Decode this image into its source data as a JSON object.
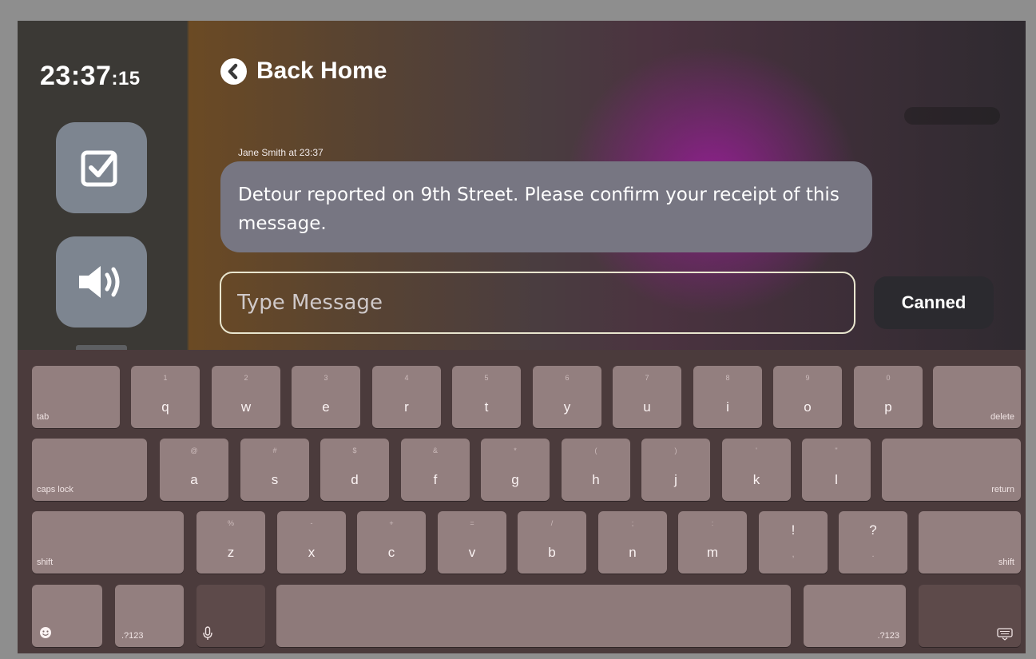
{
  "clock": {
    "hm": "23:37",
    "sec": ":15"
  },
  "sidebar": {
    "items": [
      {
        "icon": "checkbox-icon"
      },
      {
        "icon": "speaker-icon"
      }
    ]
  },
  "header": {
    "back_label": "Back Home"
  },
  "message": {
    "sender": "Jane Smith at 23:37",
    "text": "Detour reported on 9th Street. Please confirm your receipt of this message."
  },
  "compose": {
    "placeholder": "Type Message",
    "canned_label": "Canned"
  },
  "keyboard": {
    "row1": [
      {
        "key": "q",
        "alt": "1"
      },
      {
        "key": "w",
        "alt": "2"
      },
      {
        "key": "e",
        "alt": "3"
      },
      {
        "key": "r",
        "alt": "4"
      },
      {
        "key": "t",
        "alt": "5"
      },
      {
        "key": "y",
        "alt": "6"
      },
      {
        "key": "u",
        "alt": "7"
      },
      {
        "key": "i",
        "alt": "8"
      },
      {
        "key": "o",
        "alt": "9"
      },
      {
        "key": "p",
        "alt": "0"
      }
    ],
    "row2": [
      {
        "key": "a",
        "alt": "@"
      },
      {
        "key": "s",
        "alt": "#"
      },
      {
        "key": "d",
        "alt": "$"
      },
      {
        "key": "f",
        "alt": "&"
      },
      {
        "key": "g",
        "alt": "*"
      },
      {
        "key": "h",
        "alt": "("
      },
      {
        "key": "j",
        "alt": ")"
      },
      {
        "key": "k",
        "alt": "'"
      },
      {
        "key": "l",
        "alt": "\""
      }
    ],
    "row3": [
      {
        "key": "z",
        "alt": "%"
      },
      {
        "key": "x",
        "alt": "-"
      },
      {
        "key": "c",
        "alt": "+"
      },
      {
        "key": "v",
        "alt": "="
      },
      {
        "key": "b",
        "alt": "/"
      },
      {
        "key": "n",
        "alt": ";"
      },
      {
        "key": "m",
        "alt": ":"
      },
      {
        "key": ",",
        "alt": "!"
      },
      {
        "key": ".",
        "alt": "?"
      }
    ],
    "tab": "tab",
    "delete": "delete",
    "caps_lock": "caps lock",
    "return": "return",
    "shift": "shift",
    "num_left": ".?123",
    "num_right": ".?123"
  }
}
